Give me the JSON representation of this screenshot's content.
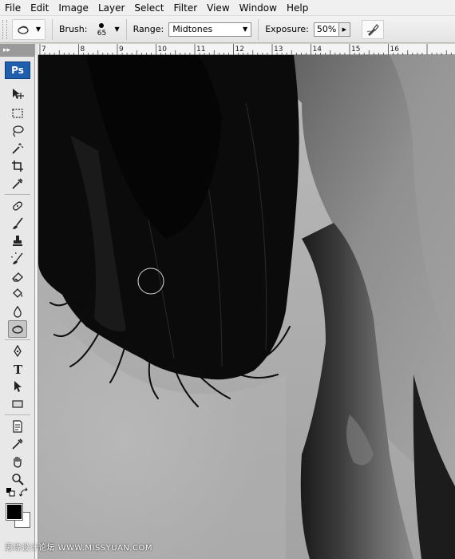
{
  "menu": [
    "File",
    "Edit",
    "Image",
    "Layer",
    "Select",
    "Filter",
    "View",
    "Window",
    "Help"
  ],
  "options": {
    "brush_label": "Brush:",
    "brush_size": "65",
    "range_label": "Range:",
    "range_value": "Midtones",
    "exposure_label": "Exposure:",
    "exposure_value": "50%"
  },
  "toolbox": {
    "logo": "Ps",
    "tools": [
      "move-tool",
      "marquee-tool",
      "lasso-tool",
      "magic-wand-tool",
      "crop-tool",
      "eyedropper-tool",
      "healing-brush-tool",
      "brush-tool",
      "clone-stamp-tool",
      "history-brush-tool",
      "eraser-tool",
      "paint-bucket-tool",
      "blur-tool",
      "dodge-burn-tool",
      "pen-tool",
      "type-tool",
      "path-selection-tool",
      "shape-tool",
      "notes-tool",
      "eyedropper-tool-2",
      "hand-tool",
      "zoom-tool"
    ],
    "active_tool": "dodge-burn-tool",
    "foreground_color": "#000000",
    "background_color": "#ffffff"
  },
  "ruler": {
    "labels": [
      "7",
      "8",
      "9",
      "10",
      "11",
      "12",
      "13",
      "14",
      "15",
      "16"
    ]
  },
  "watermark": "思缘设计论坛 WWW.MISSYUAN.COM"
}
